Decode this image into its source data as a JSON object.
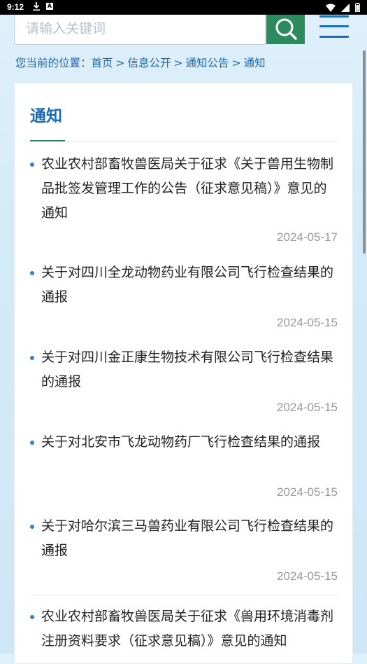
{
  "status_bar": {
    "time": "9:12",
    "notification_badge": "A"
  },
  "search": {
    "placeholder": "请输入关键词"
  },
  "breadcrumb": {
    "prefix": "您当前的位置：",
    "items": [
      "首页",
      "信息公开",
      "通知公告",
      "通知"
    ],
    "separator": ">"
  },
  "section": {
    "title": "通知"
  },
  "notices": [
    {
      "title": "农业农村部畜牧兽医局关于征求《关于兽用生物制品批签发管理工作的公告（征求意见稿）》意见的通知",
      "date": "2024-05-17"
    },
    {
      "title": "关于对四川全龙动物药业有限公司飞行检查结果的通报",
      "date": "2024-05-15"
    },
    {
      "title": "关于对四川金正康生物技术有限公司飞行检查结果的通报",
      "date": "2024-05-15"
    },
    {
      "title": "关于对北安市飞龙动物药厂飞行检查结果的通报",
      "date": "2024-05-15"
    },
    {
      "title": "关于对哈尔滨三马兽药业有限公司飞行检查结果的通报",
      "date": "2024-05-15"
    },
    {
      "title": "农业农村部畜牧兽医局关于征求《兽用环境消毒剂注册资料要求（征求意见稿）》意见的通知",
      "date": ""
    }
  ],
  "colors": {
    "accent_blue": "#1a6bb5",
    "accent_green": "#2d8a5e",
    "bullet": "#3a7fc2"
  }
}
